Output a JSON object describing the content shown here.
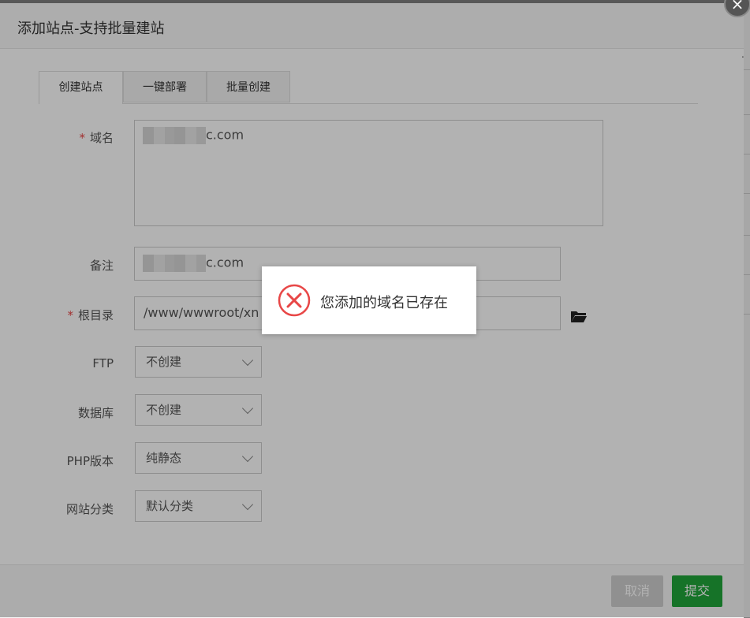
{
  "dialog": {
    "title": "添加站点-支持批量建站",
    "close_icon": "×"
  },
  "tabs": [
    "创建站点",
    "一键部署",
    "批量创建"
  ],
  "form": {
    "domain_label": "域名",
    "domain_value": "c.com",
    "remark_label": "备注",
    "remark_value": "c.com",
    "root_label": "根目录",
    "root_value": "/www/wwwroot/xn",
    "ftp_label": "FTP",
    "ftp_value": "不创建",
    "db_label": "数据库",
    "db_value": "不创建",
    "php_label": "PHP版本",
    "php_value": "纯静态",
    "category_label": "网站分类",
    "category_value": "默认分类",
    "required_mark": "*"
  },
  "footer": {
    "cancel_label": "取消",
    "submit_label": "提交"
  },
  "toast": {
    "message": "您添加的域名已存在",
    "icon": "error-circle-icon"
  },
  "colors": {
    "primary": "#20a53a",
    "error": "#e84747"
  }
}
